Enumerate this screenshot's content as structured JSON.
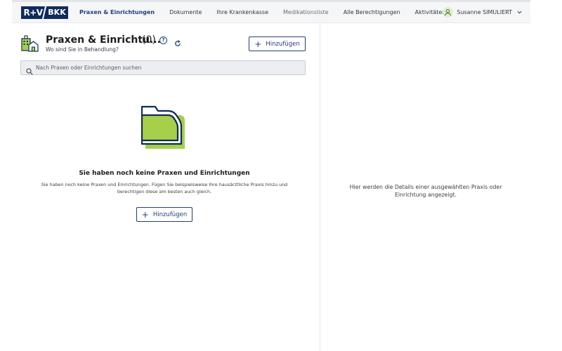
{
  "header": {
    "logo": {
      "left": "R+V",
      "right": "BKK"
    },
    "nav": [
      {
        "label": "Praxen & Einrichtungen",
        "state": "active"
      },
      {
        "label": "Dokumente",
        "state": "normal"
      },
      {
        "label": "Ihre Krankenkasse",
        "state": "normal"
      },
      {
        "label": "Medikationsliste",
        "state": "muted"
      },
      {
        "label": "Alle Berechtigungen",
        "state": "normal"
      },
      {
        "label": "Aktivitäten",
        "state": "normal"
      }
    ],
    "user": {
      "name": "Susanne SIMULIERT",
      "icon": "user-icon",
      "dropdown_icon": "chevron-down-icon"
    }
  },
  "list_panel": {
    "title": "Praxen & Einrichtu...",
    "count": "(0)",
    "subtitle": "Wo sind Sie in Behandlung?",
    "help_icon": "?",
    "add_button": "Hinzufügen",
    "search": {
      "placeholder": "Nach Praxen oder Einrichtungen suchen",
      "value": ""
    },
    "empty_state": {
      "icon": "folder-icon",
      "title": "Sie haben noch keine Praxen und Einrichtungen",
      "text": "Sie haben noch keine Praxen und Einrichtungen. Fügen Sie beispielsweise Ihre hausärztliche Praxis hinzu und berechtigen diese am besten auch gleich.",
      "add_button": "Hinzufügen"
    }
  },
  "detail_panel": {
    "placeholder": "Hier werden die Details einer ausgewählten Praxis oder Einrichtung angezeigt."
  },
  "colors": {
    "primary": "#1f3f7a",
    "brand_navy": "#0f2a5c",
    "accent_green": "#a6d049",
    "search_bg": "#eceef1"
  }
}
